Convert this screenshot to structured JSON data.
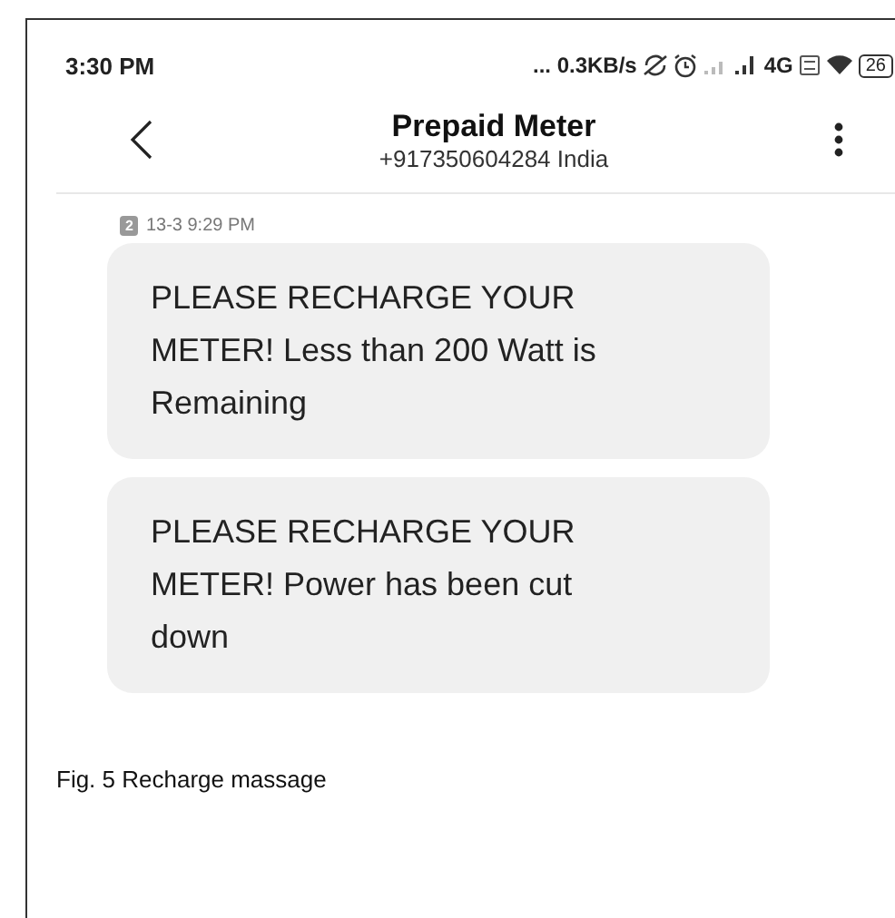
{
  "status_bar": {
    "time": "3:30 PM",
    "speed": "... 0.3KB/s",
    "network": "4G",
    "battery": "26"
  },
  "header": {
    "title": "Prepaid Meter",
    "subtitle": "+917350604284 India"
  },
  "timestamp": {
    "sim": "2",
    "time": "13-3 9:29 PM"
  },
  "messages": [
    {
      "text": "PLEASE RECHARGE YOUR METER! Less than 200 Watt is Remaining"
    },
    {
      "text": "PLEASE RECHARGE YOUR METER! Power has been cut down"
    }
  ],
  "caption": "Fig. 5 Recharge massage"
}
